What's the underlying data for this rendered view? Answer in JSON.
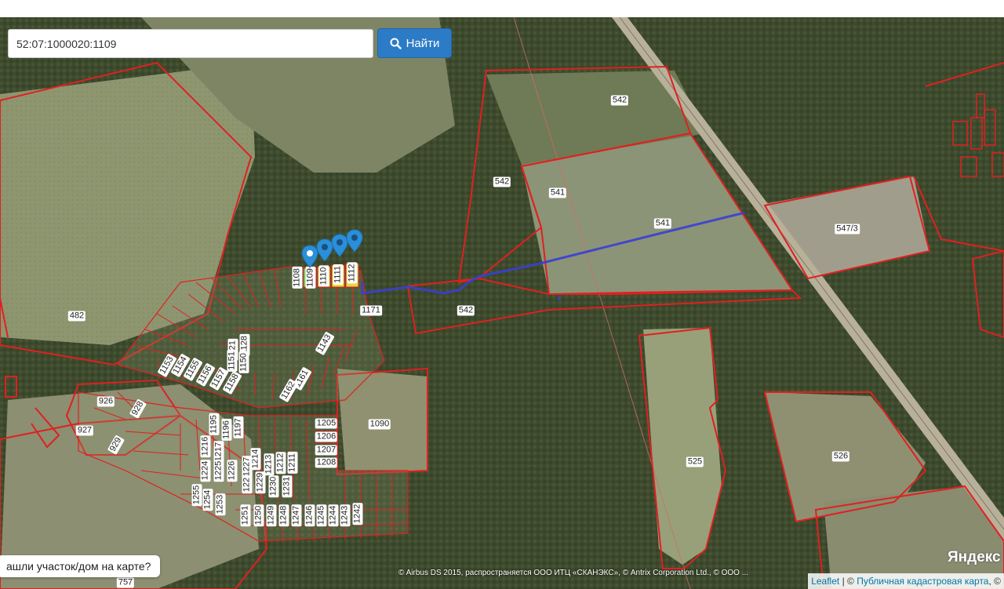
{
  "search": {
    "value": "52:07:1000020:1109",
    "button_label": "Найти"
  },
  "bottom_prompt": "ашли участок/дом на карте?",
  "imagery_copyright": "© Airbus DS 2015, распространяется ООО ИТЦ «СКАНЭКС», © Antrix Corporation Ltd., © OOO ...",
  "yandex_logo": "Яндекс",
  "attribution": {
    "leaflet": "Leaflet",
    "separator": " | © ",
    "pkk": "Публичная кадастровая карта",
    "tail": ", ©"
  },
  "parcel_labels": [
    "542",
    "542",
    "541",
    "541",
    "547/3",
    "482",
    "542",
    "1171",
    "926",
    "928",
    "927",
    "929",
    "1090",
    "526",
    "525",
    "757",
    "1205",
    "1206",
    "1207",
    "1208",
    "1121",
    "1128",
    "1150",
    "1151",
    "1143",
    "1153",
    "1154",
    "1155",
    "1156",
    "1157",
    "1158",
    "1161",
    "1162",
    "1195",
    "1196",
    "1197",
    "1216",
    "1217",
    "1214",
    "1213",
    "1212",
    "1211",
    "1228",
    "1229",
    "1230",
    "1231",
    "1224",
    "1225",
    "1226",
    "1227",
    "1255",
    "1254",
    "1253",
    "1251",
    "1250",
    "1249",
    "1248",
    "1247",
    "1246",
    "1245",
    "1244",
    "1243",
    "1242",
    "1108",
    "1109",
    "1110",
    "1111",
    "1112"
  ],
  "colors": {
    "parcel_border": "#e02020",
    "route": "#3a3fd0",
    "marker": "#2a8fd8",
    "search_button": "#2c7bc7"
  },
  "icons": {
    "search_button_icon": "magnifier-icon",
    "marker_icon": "map-pin-icon"
  }
}
